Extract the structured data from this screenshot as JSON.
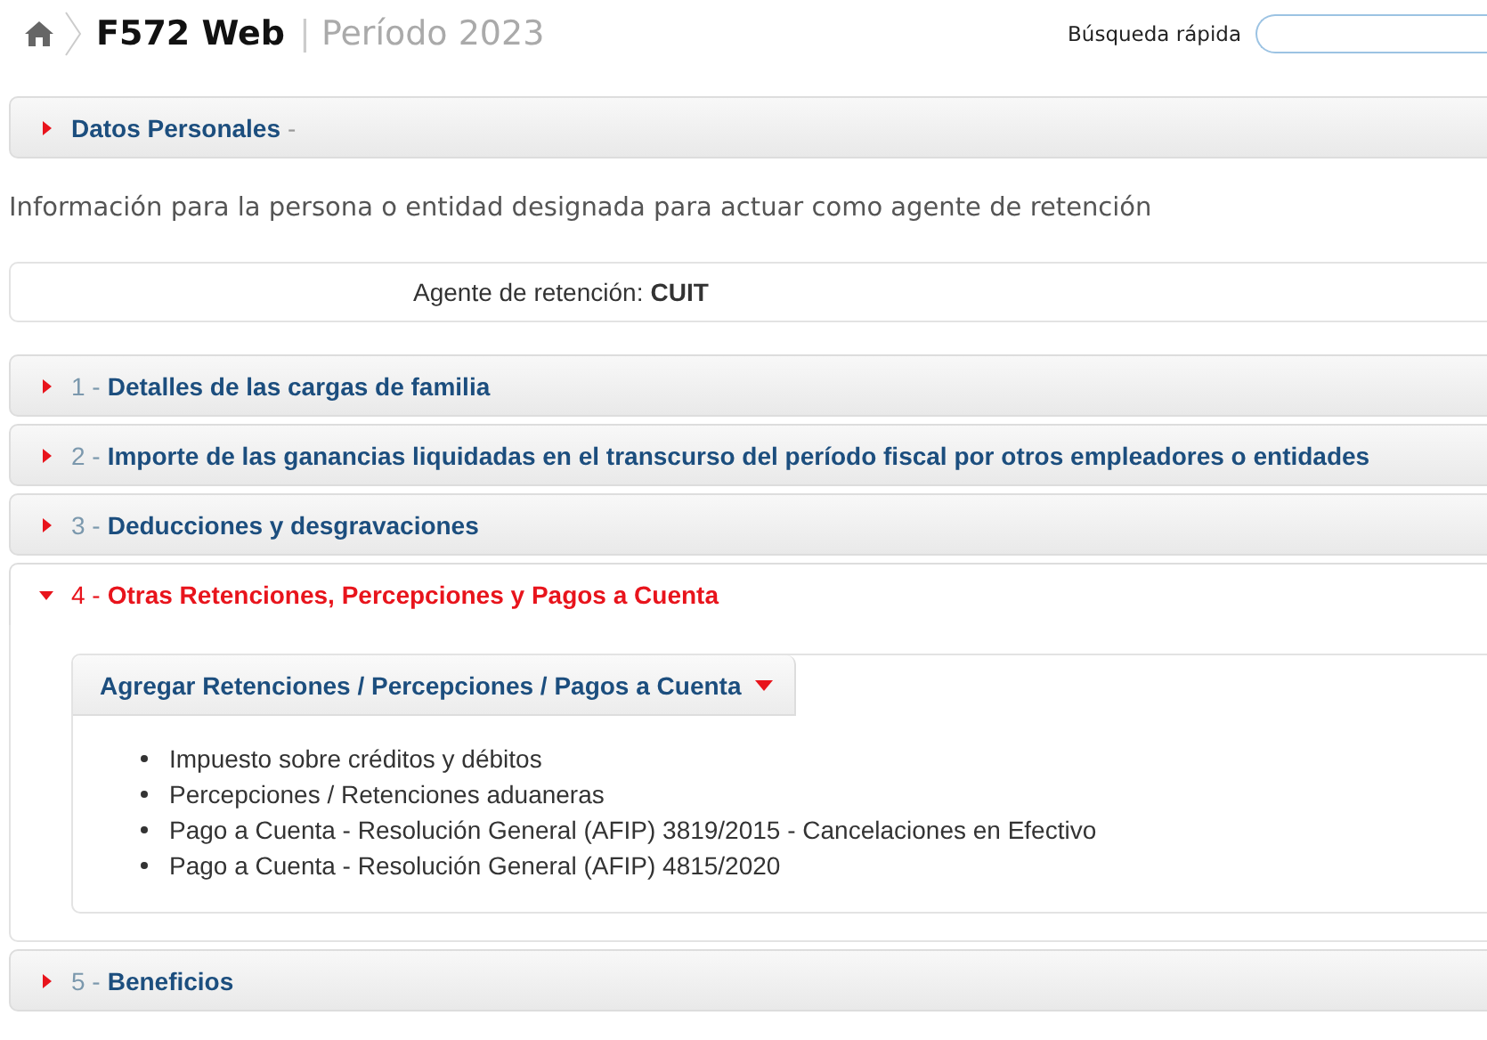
{
  "header": {
    "title": "F572 Web",
    "separator": "|",
    "period": "Período 2023",
    "search_label": "Búsqueda rápida"
  },
  "personal_section": {
    "title": "Datos Personales",
    "suffix": "-",
    "expanded": false
  },
  "info_text": "Información para la persona o entidad designada para actuar como agente de retención",
  "agent": {
    "label": "Agente de retención:",
    "value": "CUIT"
  },
  "sections": [
    {
      "number": "1 -",
      "title": "Detalles de las cargas de familia",
      "expanded": false
    },
    {
      "number": "2 -",
      "title": "Importe de las ganancias liquidadas en el transcurso del período fiscal por otros empleadores o entidades",
      "expanded": false
    },
    {
      "number": "3 -",
      "title": "Deducciones y desgravaciones",
      "expanded": false
    },
    {
      "number": "4 -",
      "title": "Otras Retenciones, Percepciones y Pagos a Cuenta",
      "expanded": true,
      "menu": {
        "label": "Agregar Retenciones / Percepciones / Pagos a Cuenta",
        "items": [
          "Impuesto sobre créditos y débitos",
          "Percepciones / Retenciones aduaneras",
          "Pago a Cuenta - Resolución General (AFIP) 3819/2015 - Cancelaciones en Efectivo",
          "Pago a Cuenta - Resolución General (AFIP) 4815/2020"
        ]
      }
    },
    {
      "number": "5 -",
      "title": "Beneficios",
      "expanded": false
    }
  ]
}
